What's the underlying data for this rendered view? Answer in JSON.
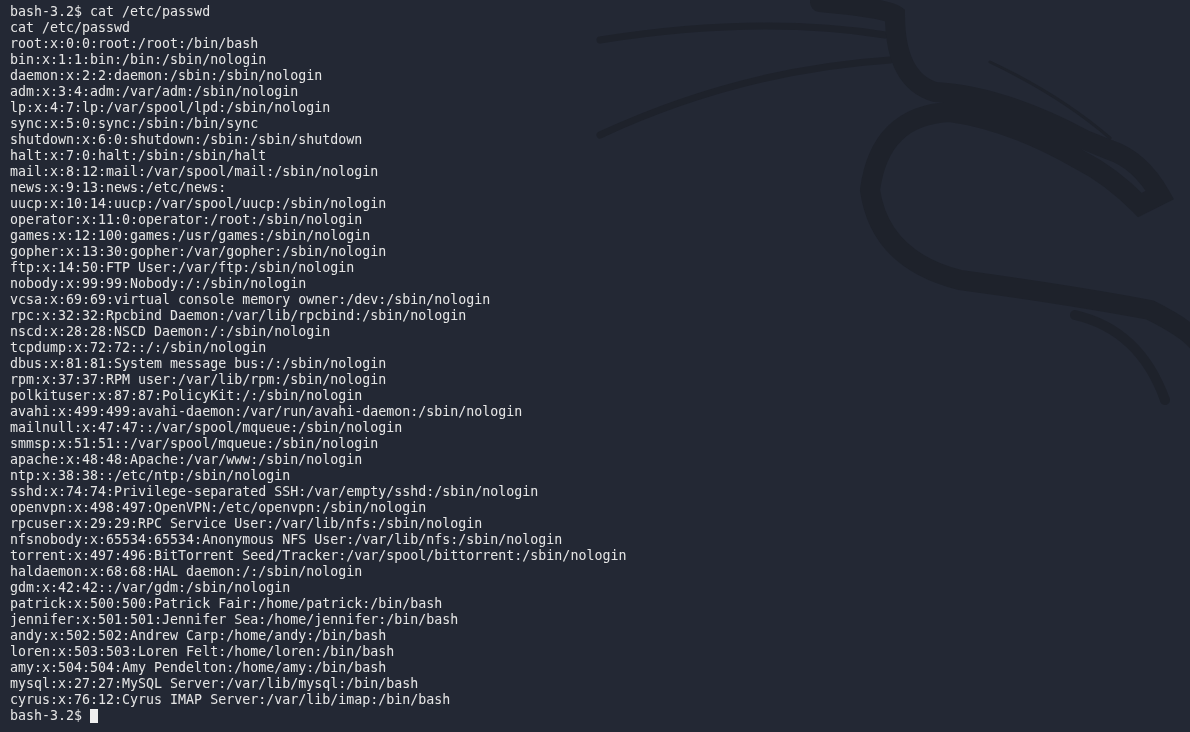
{
  "terminal": {
    "lines": [
      "bash-3.2$ cat /etc/passwd",
      "cat /etc/passwd",
      "root:x:0:0:root:/root:/bin/bash",
      "bin:x:1:1:bin:/bin:/sbin/nologin",
      "daemon:x:2:2:daemon:/sbin:/sbin/nologin",
      "adm:x:3:4:adm:/var/adm:/sbin/nologin",
      "lp:x:4:7:lp:/var/spool/lpd:/sbin/nologin",
      "sync:x:5:0:sync:/sbin:/bin/sync",
      "shutdown:x:6:0:shutdown:/sbin:/sbin/shutdown",
      "halt:x:7:0:halt:/sbin:/sbin/halt",
      "mail:x:8:12:mail:/var/spool/mail:/sbin/nologin",
      "news:x:9:13:news:/etc/news:",
      "uucp:x:10:14:uucp:/var/spool/uucp:/sbin/nologin",
      "operator:x:11:0:operator:/root:/sbin/nologin",
      "games:x:12:100:games:/usr/games:/sbin/nologin",
      "gopher:x:13:30:gopher:/var/gopher:/sbin/nologin",
      "ftp:x:14:50:FTP User:/var/ftp:/sbin/nologin",
      "nobody:x:99:99:Nobody:/:/sbin/nologin",
      "vcsa:x:69:69:virtual console memory owner:/dev:/sbin/nologin",
      "rpc:x:32:32:Rpcbind Daemon:/var/lib/rpcbind:/sbin/nologin",
      "nscd:x:28:28:NSCD Daemon:/:/sbin/nologin",
      "tcpdump:x:72:72::/:/sbin/nologin",
      "dbus:x:81:81:System message bus:/:/sbin/nologin",
      "rpm:x:37:37:RPM user:/var/lib/rpm:/sbin/nologin",
      "polkituser:x:87:87:PolicyKit:/:/sbin/nologin",
      "avahi:x:499:499:avahi-daemon:/var/run/avahi-daemon:/sbin/nologin",
      "mailnull:x:47:47::/var/spool/mqueue:/sbin/nologin",
      "smmsp:x:51:51::/var/spool/mqueue:/sbin/nologin",
      "apache:x:48:48:Apache:/var/www:/sbin/nologin",
      "ntp:x:38:38::/etc/ntp:/sbin/nologin",
      "sshd:x:74:74:Privilege-separated SSH:/var/empty/sshd:/sbin/nologin",
      "openvpn:x:498:497:OpenVPN:/etc/openvpn:/sbin/nologin",
      "rpcuser:x:29:29:RPC Service User:/var/lib/nfs:/sbin/nologin",
      "nfsnobody:x:65534:65534:Anonymous NFS User:/var/lib/nfs:/sbin/nologin",
      "torrent:x:497:496:BitTorrent Seed/Tracker:/var/spool/bittorrent:/sbin/nologin",
      "haldaemon:x:68:68:HAL daemon:/:/sbin/nologin",
      "gdm:x:42:42::/var/gdm:/sbin/nologin",
      "patrick:x:500:500:Patrick Fair:/home/patrick:/bin/bash",
      "jennifer:x:501:501:Jennifer Sea:/home/jennifer:/bin/bash",
      "andy:x:502:502:Andrew Carp:/home/andy:/bin/bash",
      "loren:x:503:503:Loren Felt:/home/loren:/bin/bash",
      "amy:x:504:504:Amy Pendelton:/home/amy:/bin/bash",
      "mysql:x:27:27:MySQL Server:/var/lib/mysql:/bin/bash",
      "cyrus:x:76:12:Cyrus IMAP Server:/var/lib/imap:/bin/bash"
    ],
    "prompt": "bash-3.2$"
  }
}
